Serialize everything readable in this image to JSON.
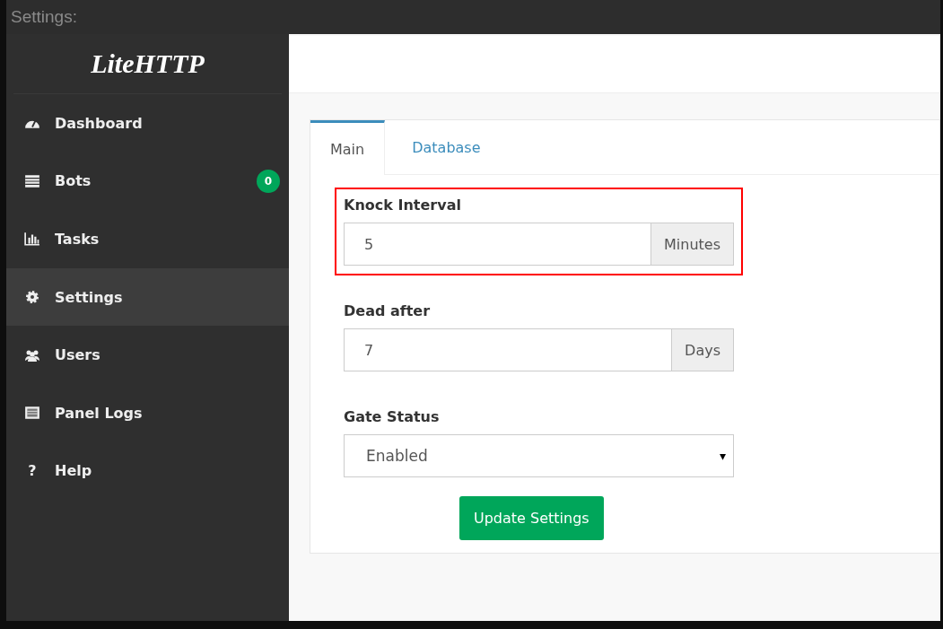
{
  "window": {
    "title": "Settings:"
  },
  "sidebar": {
    "logo": "LiteHTTP",
    "items": [
      {
        "kind": "dashboard",
        "label": "Dashboard",
        "selected": false
      },
      {
        "kind": "bots",
        "label": "Bots",
        "selected": false,
        "badge": "0"
      },
      {
        "kind": "tasks",
        "label": "Tasks",
        "selected": false
      },
      {
        "kind": "settings",
        "label": "Settings",
        "selected": true
      },
      {
        "kind": "users",
        "label": "Users",
        "selected": false
      },
      {
        "kind": "logs",
        "label": "Panel Logs",
        "selected": false
      },
      {
        "kind": "help",
        "label": "Help",
        "selected": false,
        "glyph": "?"
      }
    ]
  },
  "tabs": [
    {
      "label": "Main",
      "selected": true
    },
    {
      "label": "Database",
      "selected": false
    }
  ],
  "fields": [
    {
      "kind": "addon",
      "label": "Knock Interval",
      "value": "5",
      "addon": "Minutes",
      "highlighted": true
    },
    {
      "kind": "addon",
      "label": "Dead after",
      "value": "7",
      "addon": "Days",
      "highlighted": false
    },
    {
      "kind": "select",
      "label": "Gate Status",
      "value": "Enabled",
      "caret": "▾",
      "highlighted": false
    }
  ],
  "submit": "Update Settings"
}
